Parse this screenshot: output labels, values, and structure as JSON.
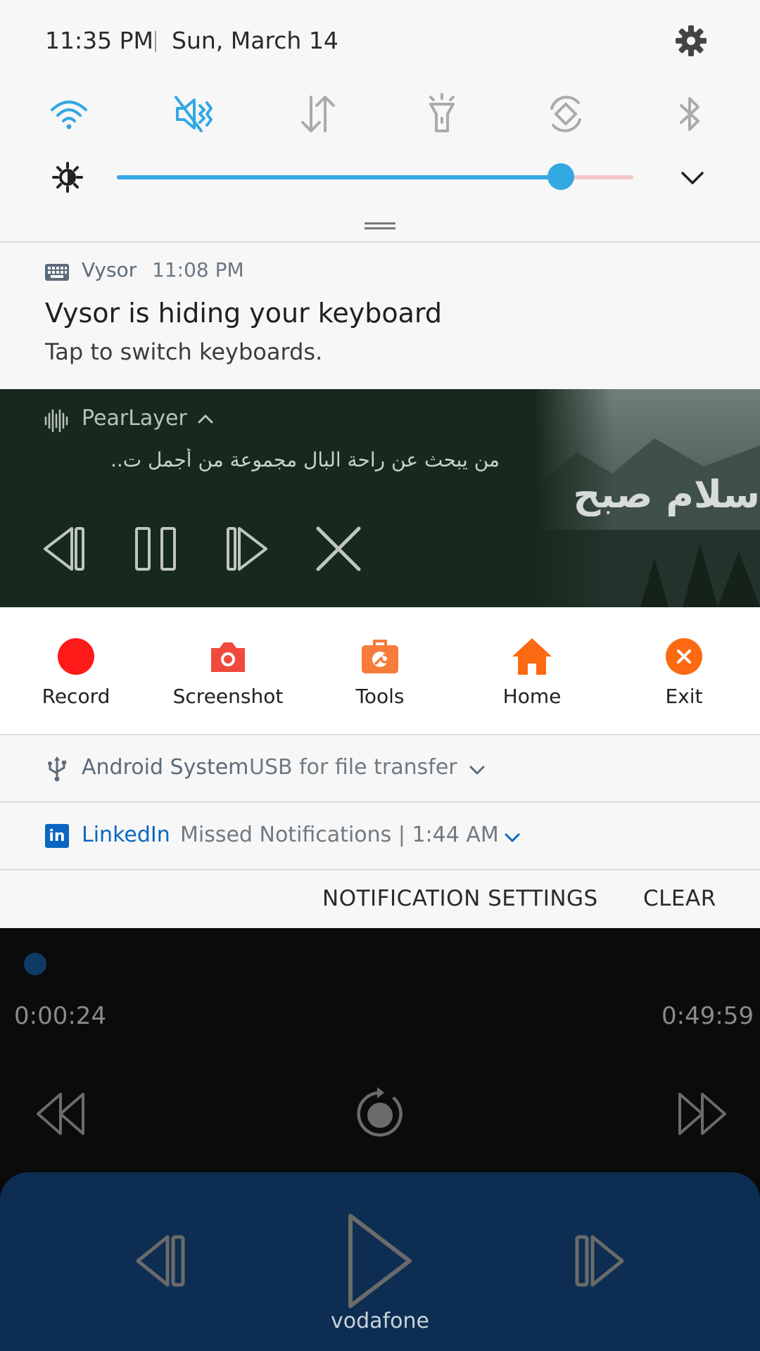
{
  "status": {
    "time": "11:35 PM",
    "date": "Sun, March 14"
  },
  "quick_settings": {
    "toggles": [
      {
        "icon": "wifi-icon",
        "active": true
      },
      {
        "icon": "mute-icon",
        "active": true
      },
      {
        "icon": "mobile-data-icon",
        "active": false
      },
      {
        "icon": "flashlight-icon",
        "active": false
      },
      {
        "icon": "auto-rotate-icon",
        "active": false
      },
      {
        "icon": "bluetooth-icon",
        "active": false
      }
    ],
    "brightness_level": 0.86,
    "accent_color": "#33a8e3"
  },
  "vysor": {
    "app": "Vysor",
    "time": "11:08 PM",
    "title": "Vysor is hiding your keyboard",
    "body": "Tap to switch keyboards."
  },
  "media": {
    "app": "PearLayer",
    "text": "من يبحث عن راحة البال    مجموعة من أجمل ت..",
    "art_text": "سلام صبح"
  },
  "toolbar": [
    {
      "label": "Record",
      "icon": "record-icon",
      "color": "#ff1a1a"
    },
    {
      "label": "Screenshot",
      "icon": "camera-icon",
      "color": "#f04a3e"
    },
    {
      "label": "Tools",
      "icon": "toolbox-icon",
      "color": "#f77b3a"
    },
    {
      "label": "Home",
      "icon": "home-icon",
      "color": "#fb6a12"
    },
    {
      "label": "Exit",
      "icon": "exit-icon",
      "color": "#fb6a12"
    }
  ],
  "android_system": {
    "app": "Android System",
    "text": "USB for file transfer"
  },
  "linkedin": {
    "app": "LinkedIn",
    "text": "Missed Notifications   |   1:44 AM",
    "logo": "in"
  },
  "actions": {
    "settings": "NOTIFICATION SETTINGS",
    "clear": "CLEAR"
  },
  "player": {
    "elapsed": "0:00:24",
    "total": "0:49:59",
    "carrier": "vodafone"
  }
}
